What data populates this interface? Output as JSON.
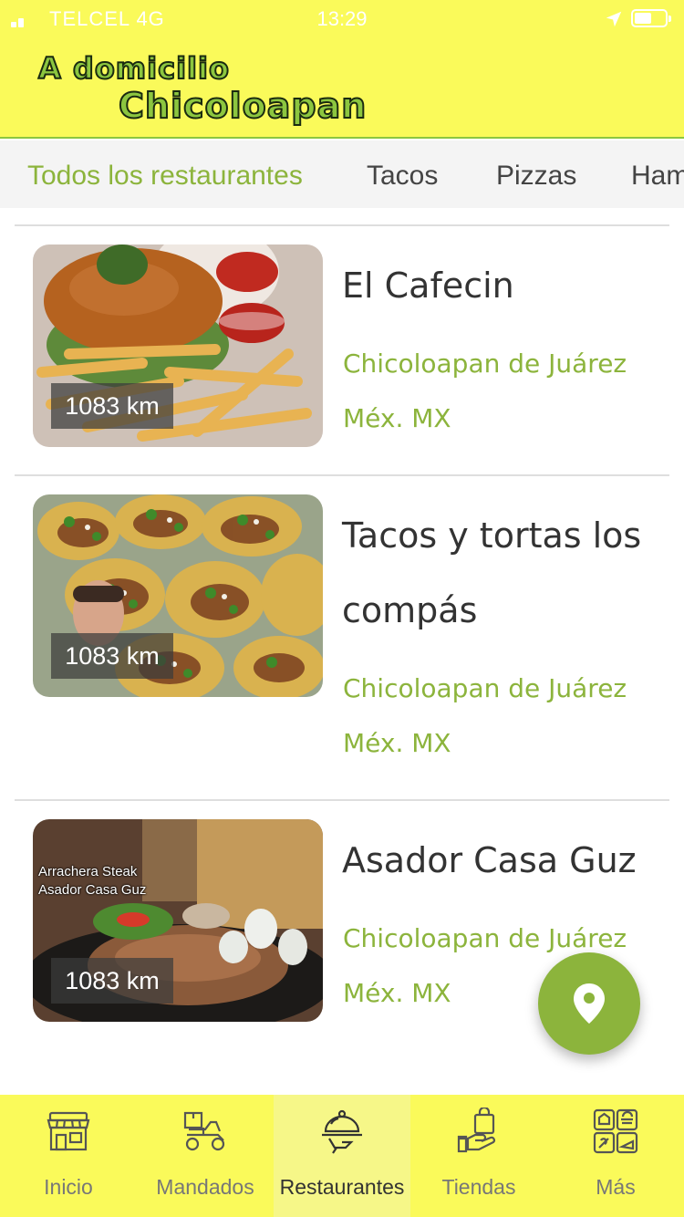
{
  "status_bar": {
    "carrier": "TELCEL  4G",
    "time": "13:29"
  },
  "header": {
    "logo_line1": "A domicilio",
    "logo_line2": "Chicoloapan"
  },
  "tabs": [
    {
      "label": "Todos los restaurantes"
    },
    {
      "label": "Tacos"
    },
    {
      "label": "Pizzas"
    },
    {
      "label": "Ham"
    }
  ],
  "restaurants": [
    {
      "name": "El Cafecin",
      "city": "Chicoloapan de Juárez",
      "state": "Méx. MX",
      "distance": "1083 km"
    },
    {
      "name": "Tacos y tortas los compás",
      "city": "Chicoloapan de Juárez",
      "state": "Méx. MX",
      "distance": "1083 km"
    },
    {
      "name": "Asador Casa Guz",
      "city": "Chicoloapan de Juárez",
      "state": "Méx. MX",
      "distance": "1083 km",
      "photo_caption_1": "Arrachera Steak",
      "photo_caption_2": "Asador Casa Guz"
    }
  ],
  "fab": {
    "icon": "location-pin-icon"
  },
  "bottom_nav": [
    {
      "label": "Inicio",
      "icon": "store-icon"
    },
    {
      "label": "Mandados",
      "icon": "delivery-scooter-icon"
    },
    {
      "label": "Restaurantes",
      "icon": "food-tray-icon",
      "active": true
    },
    {
      "label": "Tiendas",
      "icon": "bag-hand-icon"
    },
    {
      "label": "Más",
      "icon": "grid-icon"
    }
  ],
  "colors": {
    "header_bg": "#fafa5a",
    "accent": "#8cb43c",
    "nav_active_bg": "#f6f788",
    "text_dark": "#333333"
  }
}
